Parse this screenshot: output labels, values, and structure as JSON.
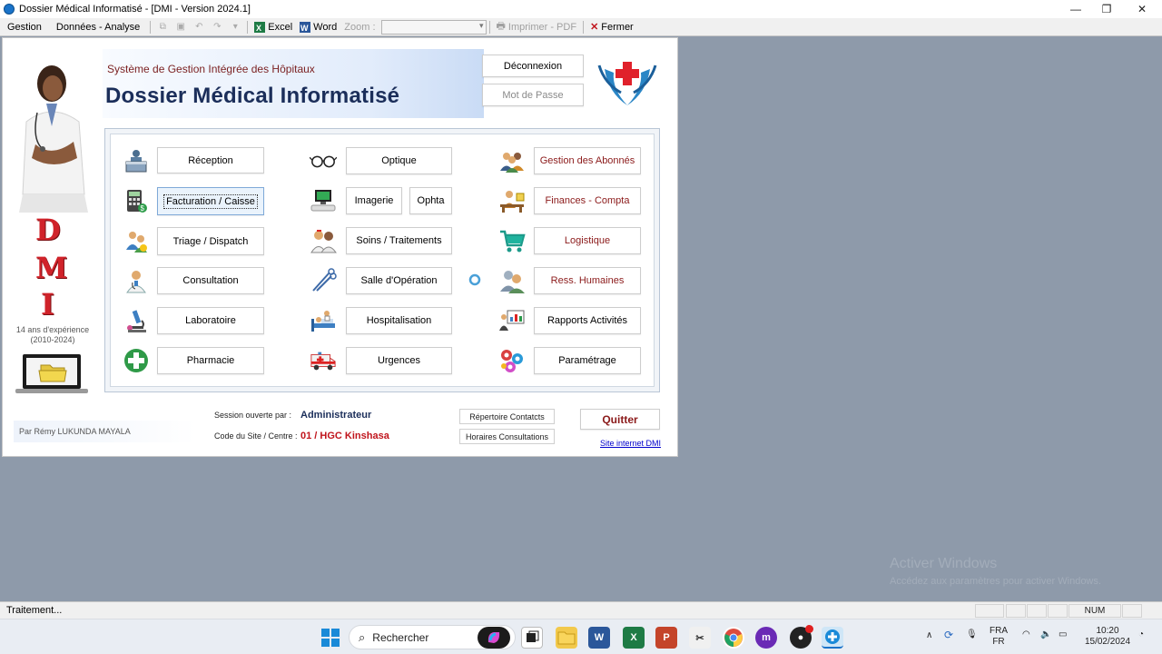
{
  "window": {
    "title": "Dossier Médical Informatisé - [DMI - Version 2024.1]",
    "minimize_glyph": "—",
    "maximize_glyph": "❐",
    "close_glyph": "✕"
  },
  "menubar": {
    "gestion": "Gestion",
    "donnees": "Données - Analyse",
    "excel": "Excel",
    "word": "Word",
    "zoom_label": "Zoom :",
    "zoom_value": "",
    "imprimer": "Imprimer - PDF",
    "fermer": "Fermer"
  },
  "header": {
    "subtitle": "Système de Gestion Intégrée des Hôpitaux",
    "title": "Dossier Médical Informatisé",
    "deconnexion": "Déconnexion",
    "mot_de_passe": "Mot de Passe"
  },
  "sidebar": {
    "dmi_letters": [
      "D",
      "M",
      "I"
    ],
    "experience_line1": "14 ans d'expérience",
    "experience_line2": "(2010-2024)",
    "author": "Par Rémy LUKUNDA MAYALA"
  },
  "modules": {
    "col1": [
      "Réception",
      "Facturation / Caisse",
      "Triage / Dispatch",
      "Consultation",
      "Laboratoire",
      "Pharmacie"
    ],
    "col2": [
      "Optique",
      "Imagerie",
      "Ophta",
      "Soins / Traitements",
      "Salle d'Opération",
      "Hospitalisation",
      "Urgences"
    ],
    "col3": [
      "Gestion des Abonnés",
      "Finances - Compta",
      "Logistique",
      "Ress. Humaines",
      "Rapports Activités",
      "Paramétrage"
    ]
  },
  "footer": {
    "session_label": "Session ouverte par :",
    "session_user": "Administrateur",
    "site_label": "Code du Site / Centre :",
    "site_value": "01 / HGC Kinshasa",
    "repertoire": "Répertoire Contatcts",
    "horaires": "Horaires Consultations",
    "quitter": "Quitter",
    "site_internet": "Site internet DMI"
  },
  "watermark": {
    "line1": "Activer Windows",
    "line2": "Accédez aux paramètres pour activer Windows."
  },
  "statusbar": {
    "text": "Traitement...",
    "num": "NUM"
  },
  "taskbar": {
    "search_placeholder": "Rechercher",
    "lang1": "FRA",
    "lang2": "FR",
    "time": "10:20",
    "date": "15/02/2024"
  },
  "colors": {
    "title_navy": "#1b2e5a",
    "subtitle_maroon": "#7a1f1f",
    "dmi_red": "#d0232a",
    "session_navy": "#1b2e5a",
    "site_red": "#c0141c",
    "quit_maroon": "#8b1a1a",
    "background": "#8e9aaa"
  }
}
